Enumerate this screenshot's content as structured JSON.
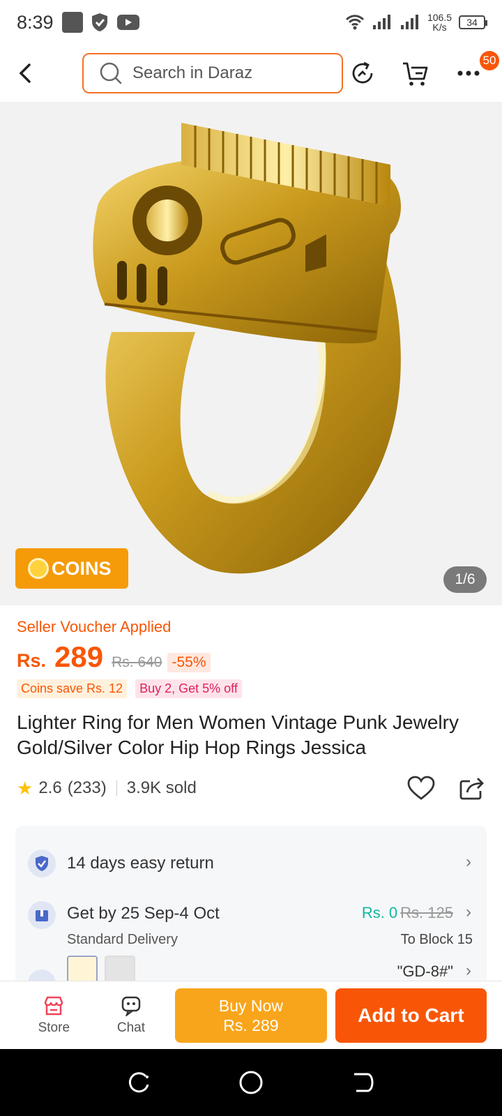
{
  "status": {
    "time": "8:39",
    "speed_value": "106.5",
    "speed_unit": "K/s",
    "battery": "34"
  },
  "search": {
    "placeholder": "Search in Daraz"
  },
  "header": {
    "more_badge": "50"
  },
  "hero": {
    "coins_label": "COINS",
    "pager": "1/6"
  },
  "price": {
    "voucher": "Seller Voucher Applied",
    "currency": "Rs.",
    "current": "289",
    "original": "Rs. 640",
    "discount": "-55%",
    "tag_coins": "Coins save Rs. 12",
    "tag_bundle": "Buy 2, Get 5% off"
  },
  "product": {
    "title": "Lighter Ring for Men Women Vintage Punk Jewelry Gold/Silver Color Hip Hop Rings Jessica",
    "rating": "2.6",
    "reviews": "(233)",
    "sold": "3.9K sold"
  },
  "services": {
    "returns": "14 days easy return",
    "delivery_title": "Get by 25 Sep-4 Oct",
    "delivery_type": "Standard Delivery",
    "fee_new": "Rs. 0",
    "fee_old": "Rs. 125",
    "to_block": "To Block 15",
    "variant": "\"GD-8#\""
  },
  "bottom": {
    "store": "Store",
    "chat": "Chat",
    "buy_now": "Buy Now",
    "buy_now_price": "Rs. 289",
    "add_to_cart": "Add to Cart"
  },
  "colors": {
    "accent": "#f85606",
    "buy_now": "#f9a51b",
    "free_shipping": "#13b7a0"
  }
}
